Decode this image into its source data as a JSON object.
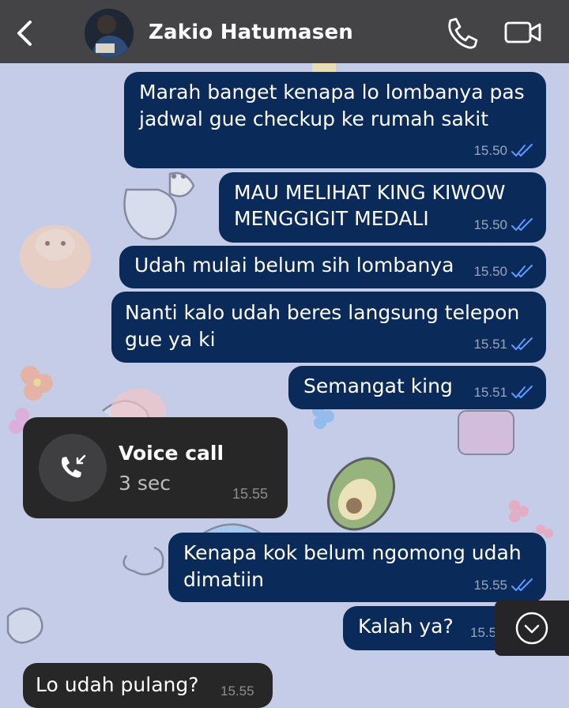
{
  "header": {
    "contact_name": "Zakio Hatumasen",
    "back_icon": "chevron-left-icon",
    "call_icon": "phone-icon",
    "video_icon": "video-camera-icon"
  },
  "messages": [
    {
      "lines": [
        "Marah banget kenapa lo lombanya pas",
        "jadwal gue checkup ke rumah sakit"
      ],
      "time": "15.50",
      "status": "read"
    },
    {
      "lines": [
        "MAU MELIHAT KING KIWOW",
        "MENGGIGIT MEDALI"
      ],
      "time": "15.50",
      "status": "read"
    },
    {
      "lines": [
        "Udah mulai belum sih lombanya"
      ],
      "time": "15.50",
      "status": "read"
    },
    {
      "lines": [
        "Nanti kalo udah beres langsung telepon",
        "gue ya ki"
      ],
      "time": "15.51",
      "status": "read"
    },
    {
      "lines": [
        "Semangat king"
      ],
      "time": "15.51",
      "status": "read"
    },
    {
      "lines": [
        "Kenapa kok belum ngomong udah",
        "dimatiin"
      ],
      "time": "15.55",
      "status": "read"
    },
    {
      "lines": [
        "Kalah ya?"
      ],
      "time": "15.5",
      "status": "read"
    }
  ],
  "voice_call": {
    "title": "Voice call",
    "duration": "3 sec",
    "time": "15.55",
    "icon": "incoming-call-icon"
  },
  "incoming": {
    "text": "Lo udah pulang?",
    "time": "15.55"
  },
  "scroll_button": {
    "icon": "chevron-down-circle-icon"
  },
  "colors": {
    "header": "#444446",
    "chat_background": "#c5cce7",
    "outgoing_bubble": "#0a2a5a",
    "incoming_bubble": "#272728",
    "read_tick": "#5b9bff"
  }
}
